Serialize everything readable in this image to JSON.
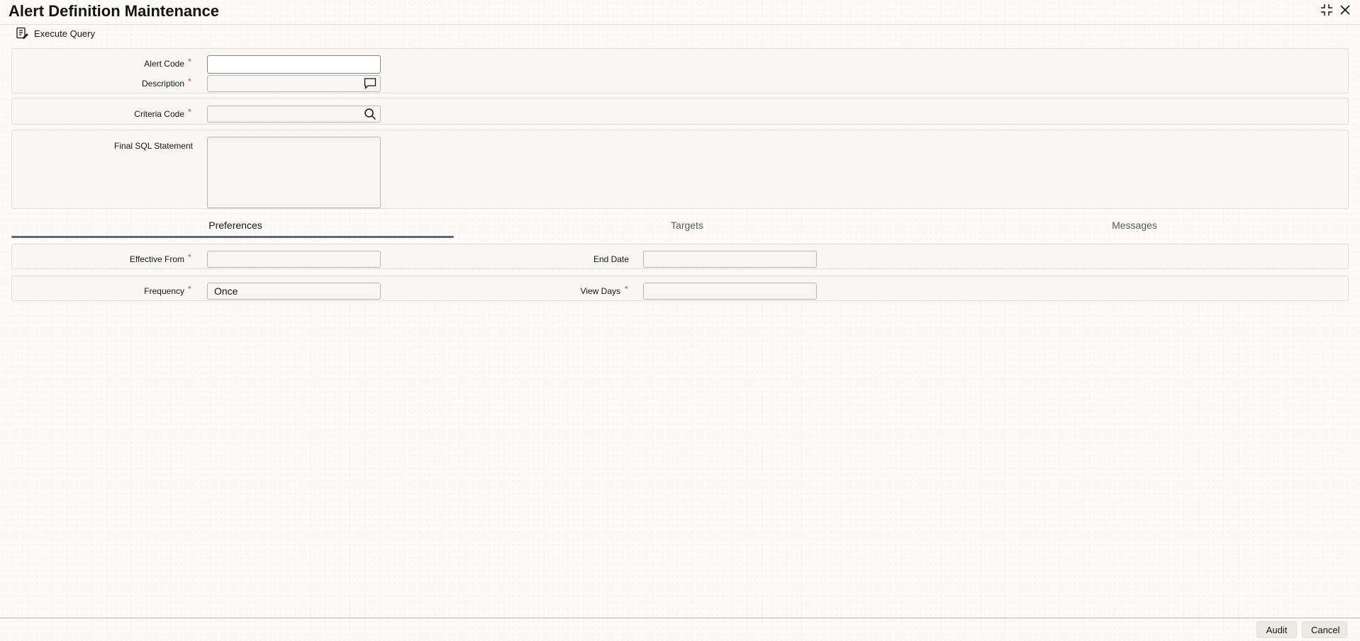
{
  "window": {
    "title": "Alert Definition Maintenance",
    "controls": [
      "collapse-icon",
      "close-icon"
    ]
  },
  "toolbar": {
    "execute_query_label": "Execute Query",
    "execute_query_icon": "query-document-icon"
  },
  "form": {
    "alert_code": {
      "label": "Alert Code",
      "required": "*",
      "value": ""
    },
    "description": {
      "label": "Description",
      "required": "*",
      "value": "",
      "icon": "comment-icon"
    },
    "criteria_code": {
      "label": "Criteria Code",
      "required": "*",
      "value": "",
      "icon": "search-icon"
    },
    "final_sql": {
      "label": "Final SQL Statement",
      "value": ""
    }
  },
  "tabs": [
    {
      "label": "Preferences",
      "selected": true
    },
    {
      "label": "Targets",
      "selected": false
    },
    {
      "label": "Messages",
      "selected": false
    }
  ],
  "preferences": {
    "effective_from": {
      "label": "Effective From",
      "required": "*",
      "value": ""
    },
    "end_date": {
      "label": "End Date",
      "value": ""
    },
    "frequency": {
      "label": "Frequency",
      "required": "*",
      "value": "Once"
    },
    "view_days": {
      "label": "View Days",
      "required": "*",
      "value": ""
    }
  },
  "footer": {
    "audit_label": "Audit",
    "cancel_label": "Cancel"
  },
  "colors": {
    "required": "#c74634",
    "tab_underline": "#596a7e",
    "background": "#fbfaf9"
  }
}
